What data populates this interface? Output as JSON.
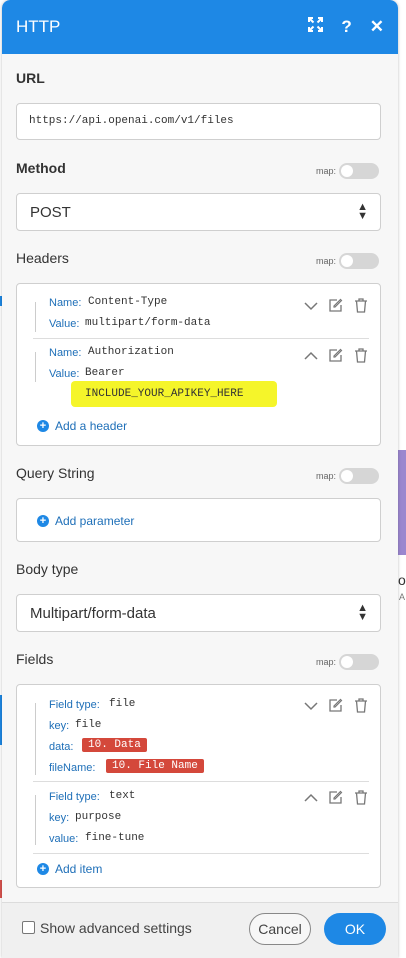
{
  "dialog": {
    "title": "HTTP",
    "title_icons": [
      "expand-icon",
      "help-icon",
      "close-icon"
    ]
  },
  "map_label": "map:",
  "url": {
    "label": "URL",
    "value": "https://api.openai.com/v1/files"
  },
  "method": {
    "label": "Method",
    "value": "POST"
  },
  "headers": {
    "label": "Headers",
    "items": [
      {
        "name_key": "Name:",
        "name": "Content-Type",
        "value_key": "Value:",
        "value": "multipart/form-data"
      },
      {
        "name_key": "Name:",
        "name": "Authorization",
        "value_key": "Value:",
        "value": "Bearer",
        "value_extra": "INCLUDE_YOUR_APIKEY_HERE"
      }
    ],
    "add_label": "Add a header"
  },
  "query_string": {
    "label": "Query String",
    "add_label": "Add parameter"
  },
  "body_type": {
    "label": "Body type",
    "value": "Multipart/form-data"
  },
  "fields": {
    "label": "Fields",
    "items": [
      {
        "type_key": "Field type:",
        "type": "file",
        "key_key": "key:",
        "key": "file",
        "data_key": "data:",
        "data": "10. Data",
        "filename_key": "fileName:",
        "filename": "10. File Name"
      },
      {
        "type_key": "Field type:",
        "type": "text",
        "key_key": "key:",
        "key": "purpose",
        "value_key": "value:",
        "value": "fine-tune"
      }
    ],
    "add_label": "Add item"
  },
  "footer": {
    "advanced_label": "Show advanced settings",
    "cancel_label": "Cancel",
    "ok_label": "OK"
  },
  "colors": {
    "accent": "#1e88e5",
    "highlight": "#f5f52a",
    "pill": "#d4483b"
  },
  "background_canvas": {
    "partial_text_1": "o",
    "partial_text_2": "A"
  }
}
